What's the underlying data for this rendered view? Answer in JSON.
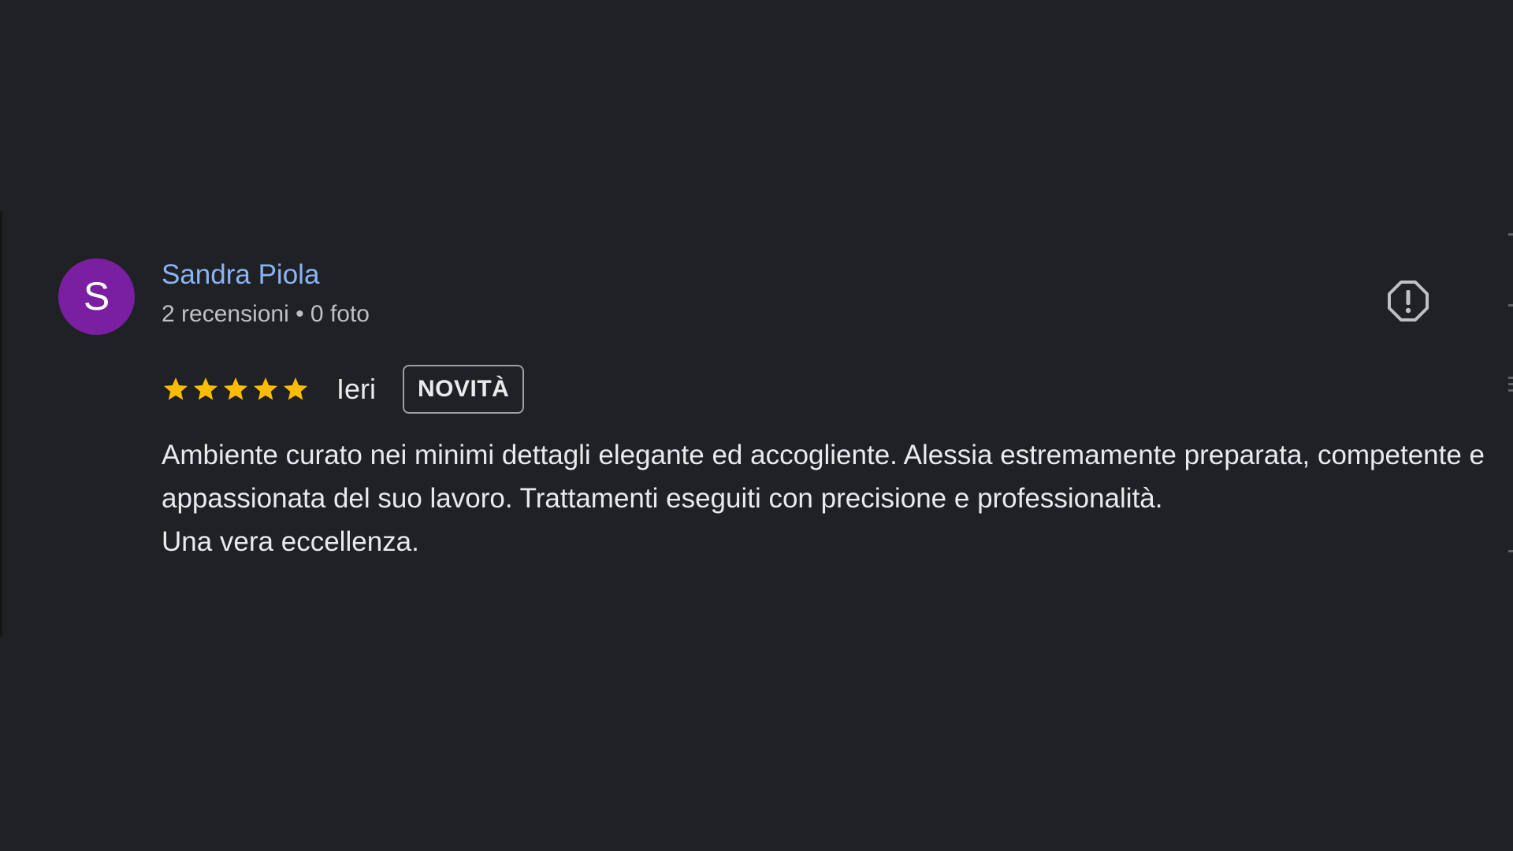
{
  "review": {
    "avatar_letter": "S",
    "avatar_color": "#7b1fa2",
    "author_name": "Sandra Piola",
    "author_meta": "2 recensioni • 0 foto",
    "rating": 5,
    "rating_max": 5,
    "star_color": "#fbbc04",
    "date": "Ieri",
    "badge": "NOVITÀ",
    "text": "Ambiente curato nei minimi dettagli elegante ed accogliente. Alessia estremamente preparata, competente e appassionata del suo lavoro. Trattamenti eseguiti con precisione e professionalità.\nUna vera eccellenza.",
    "report_icon": "report-icon"
  },
  "colors": {
    "background": "#202124",
    "link": "#8ab4f8",
    "secondary_text": "#bdc1c6",
    "primary_text": "#e8eaed"
  }
}
